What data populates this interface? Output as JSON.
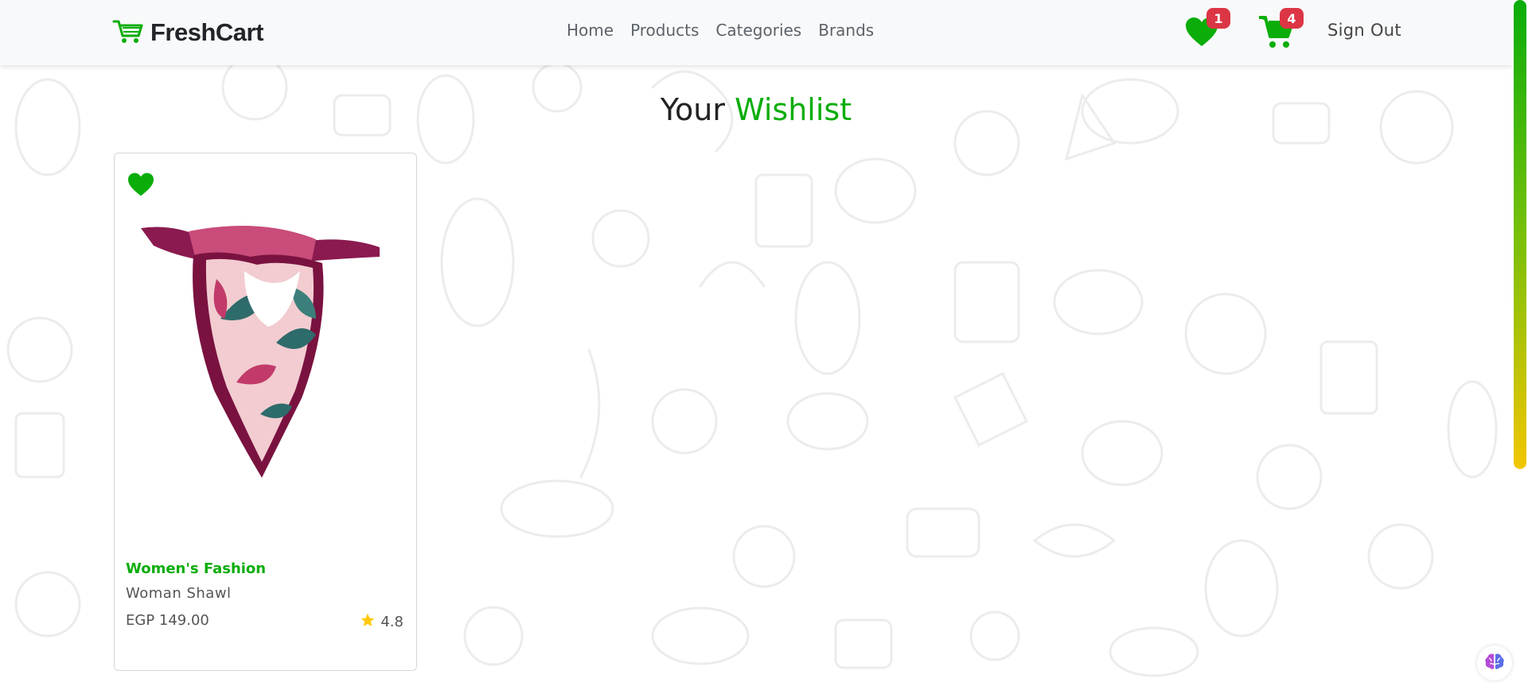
{
  "brand": {
    "name": "FreshCart",
    "icon": "cart-icon"
  },
  "nav": {
    "links": [
      {
        "label": "Home"
      },
      {
        "label": "Products"
      },
      {
        "label": "Categories"
      },
      {
        "label": "Brands"
      }
    ],
    "wishlist": {
      "icon": "heart-icon",
      "count": "1"
    },
    "cart": {
      "icon": "cart-icon",
      "count": "4"
    },
    "sign_out": "Sign Out"
  },
  "page": {
    "title_prefix": "Your",
    "title_accent": "Wishlist"
  },
  "wishlist_items": [
    {
      "category": "Women's Fashion",
      "name": "Woman Shawl",
      "price": "EGP 149.00",
      "rating": "4.8",
      "icon": "heart-icon"
    }
  ],
  "colors": {
    "accent": "#0aad0a",
    "badge": "#dc3545",
    "star": "#ffc908"
  }
}
